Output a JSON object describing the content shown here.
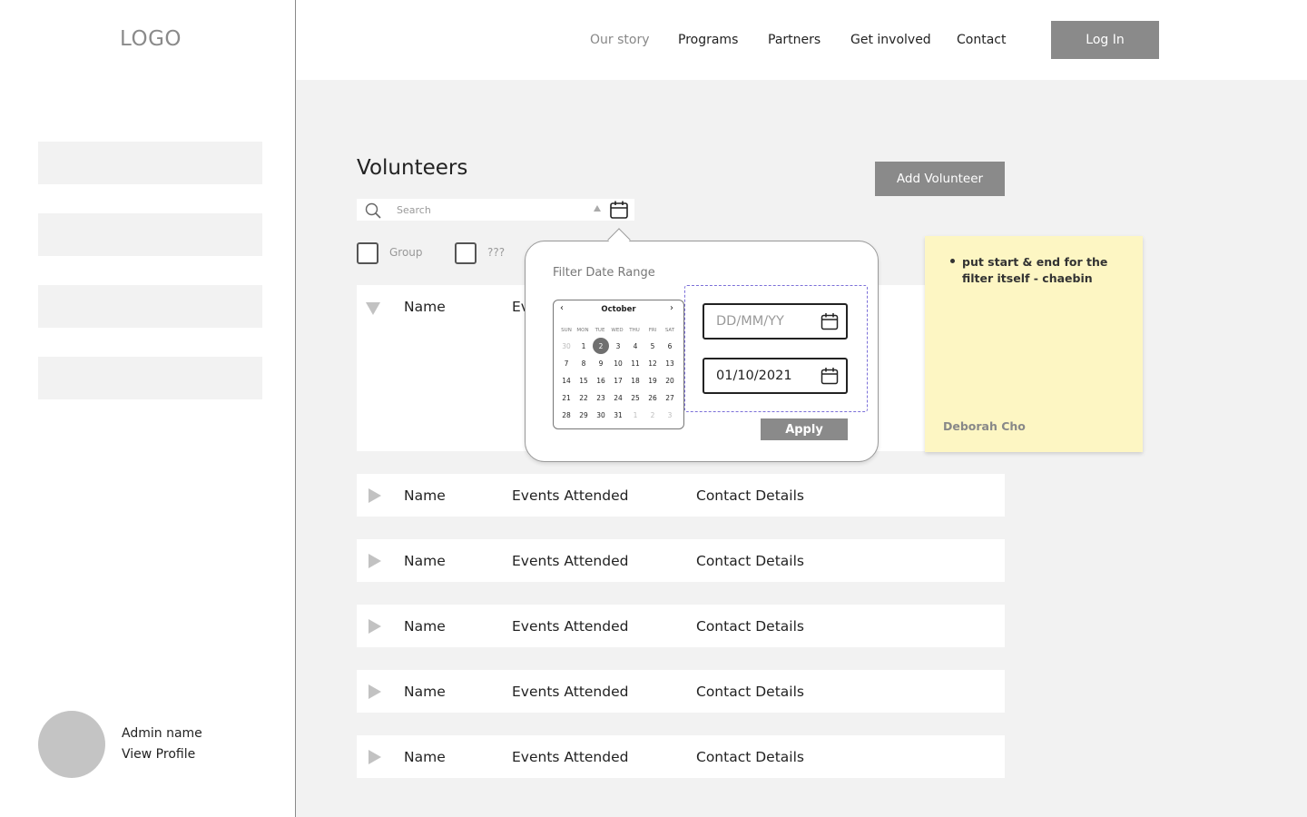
{
  "logo": "LOGO",
  "nav": {
    "links": [
      "Our story",
      "Programs",
      "Partners",
      "Get involved",
      "Contact"
    ],
    "login_label": "Log In"
  },
  "sidebar": {
    "admin_name": "Admin name",
    "view_profile": "View Profile"
  },
  "page": {
    "title": "Volunteers",
    "add_button": "Add Volunteer"
  },
  "search": {
    "placeholder": "Search"
  },
  "filters": {
    "checkbox_labels": [
      "Group",
      "???"
    ]
  },
  "table": {
    "expanded_row": {
      "name": "Name",
      "events_partial": "Ev"
    },
    "rows": [
      {
        "name": "Name",
        "events": "Events Attended",
        "contact": "Contact Details"
      },
      {
        "name": "Name",
        "events": "Events Attended",
        "contact": "Contact Details"
      },
      {
        "name": "Name",
        "events": "Events Attended",
        "contact": "Contact Details"
      },
      {
        "name": "Name",
        "events": "Events Attended",
        "contact": "Contact Details"
      },
      {
        "name": "Name",
        "events": "Events Attended",
        "contact": "Contact Details"
      }
    ]
  },
  "date_filter": {
    "title": "Filter Date Range",
    "calendar": {
      "month": "October",
      "prev": "‹",
      "next": "›",
      "weekdays": [
        "SUN",
        "MON",
        "TUE",
        "WED",
        "THU",
        "FRI",
        "SAT"
      ],
      "weeks": [
        [
          "30",
          "1",
          "2",
          "3",
          "4",
          "5",
          "6"
        ],
        [
          "7",
          "8",
          "9",
          "10",
          "11",
          "12",
          "13"
        ],
        [
          "14",
          "15",
          "16",
          "17",
          "18",
          "19",
          "20"
        ],
        [
          "21",
          "22",
          "23",
          "24",
          "25",
          "26",
          "27"
        ],
        [
          "28",
          "29",
          "30",
          "31",
          "1",
          "2",
          "3"
        ]
      ],
      "selected_day": "2"
    },
    "start_placeholder": "DD/MM/YY",
    "end_value": "01/10/2021",
    "apply_label": "Apply"
  },
  "sticky_note": {
    "text": "put start & end for the filter itself - chaebin",
    "author": "Deborah Cho"
  },
  "colors": {
    "button_gray": "#8a8a8a",
    "panel_bg": "#f2f2f2",
    "sticky_bg": "#fdf6c3",
    "dashed_accent": "#7b6fd8"
  }
}
